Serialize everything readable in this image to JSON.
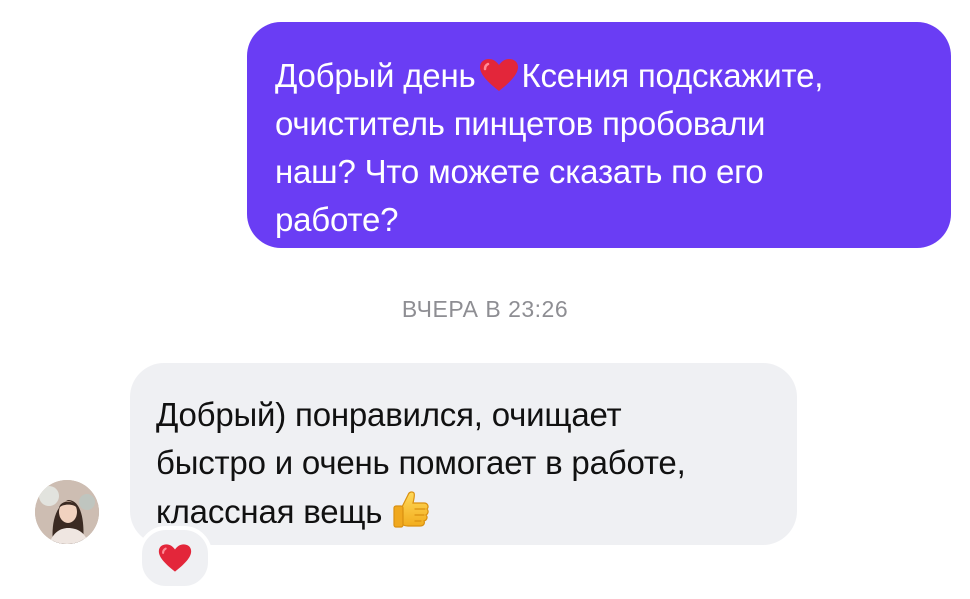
{
  "conversation": {
    "outgoing_message": {
      "lines": [
        "Добрый день",
        "Ксения подскажите,",
        "очиститель пинцетов пробовали",
        "наш? Что можете сказать по его",
        "работе?"
      ],
      "inline_emoji": "red-heart-icon",
      "bubble_color": "#6a3df4",
      "text_color": "#ffffff"
    },
    "timestamp": "ВЧЕРА В 23:26",
    "incoming_message": {
      "lines": [
        "Добрый) понравился, очищает",
        "быстро и очень помогает в работе,",
        "классная вещь"
      ],
      "inline_emoji": "thumbs-up-icon",
      "bubble_color": "#eff0f3",
      "text_color": "#111111"
    },
    "sender_avatar": "avatar-photo",
    "reaction": "red-heart-icon"
  }
}
